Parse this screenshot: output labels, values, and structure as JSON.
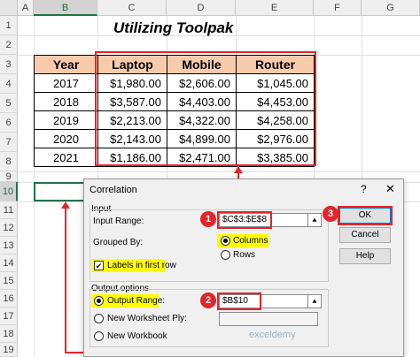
{
  "spreadsheet": {
    "columns": [
      "A",
      "B",
      "C",
      "D",
      "E",
      "F",
      "G"
    ],
    "rows": [
      "1",
      "2",
      "3",
      "4",
      "5",
      "6",
      "7",
      "8",
      "9",
      "10",
      "11",
      "12",
      "13",
      "14",
      "15",
      "16",
      "17",
      "18",
      "19"
    ],
    "title": "Utilizing Toolpak",
    "table": {
      "headers": [
        "Year",
        "Laptop",
        "Mobile",
        "Router"
      ],
      "rows": [
        [
          "2017",
          "$1,980.00",
          "$2,606.00",
          "$1,045.00"
        ],
        [
          "2018",
          "$3,587.00",
          "$4,403.00",
          "$4,453.00"
        ],
        [
          "2019",
          "$2,213.00",
          "$4,322.00",
          "$4,258.00"
        ],
        [
          "2020",
          "$2,143.00",
          "$4,899.00",
          "$2,976.00"
        ],
        [
          "2021",
          "$1,186.00",
          "$2,471.00",
          "$3,385.00"
        ]
      ]
    }
  },
  "dialog": {
    "title": "Correlation",
    "help_glyph": "?",
    "close_glyph": "✕",
    "input_group_label": "Input",
    "input_range_label": "Input Range:",
    "input_range_value": "$C$3:$E$8",
    "grouped_by_label": "Grouped By:",
    "columns_option": "Columns",
    "rows_option": "Rows",
    "labels_checkbox": "Labels in first row",
    "output_group_label": "Output options",
    "output_range_label": "Output Range:",
    "output_range_value": "$B$10",
    "new_worksheet_label": "New Worksheet Ply:",
    "new_workbook_label": "New Workbook",
    "ok_label": "OK",
    "cancel_label": "Cancel",
    "help_label": "Help",
    "collapse_icon_glyph": "⯅"
  },
  "callouts": [
    "1",
    "2",
    "3"
  ],
  "watermark": "exceldemy",
  "colors": {
    "accent_red": "#e2252a",
    "header_fill": "#f8cbad",
    "highlight": "#ffff00",
    "excel_green": "#217346"
  }
}
